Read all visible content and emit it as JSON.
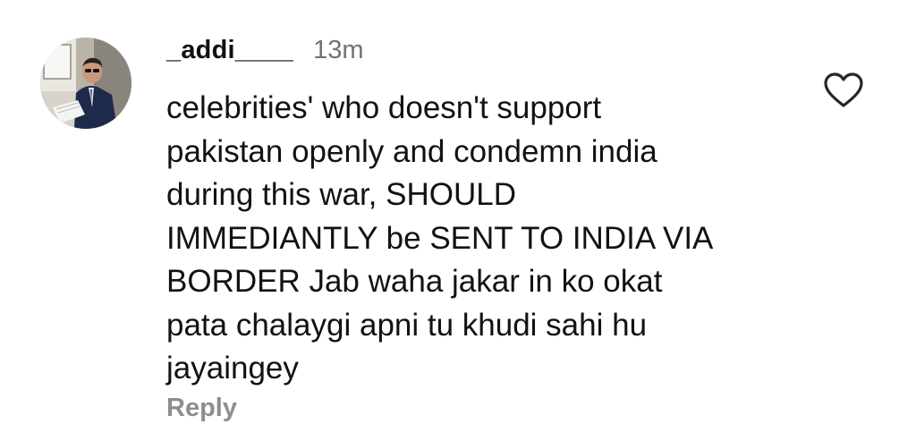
{
  "comment": {
    "username": "_addi____",
    "timestamp": "13m",
    "text": "celebrities' who doesn't support\npakistan openly and condemn india\nduring this war, SHOULD\nIMMEDIANTLY be SENT TO INDIA VIA\nBORDER Jab waha jakar in ko okat\npata chalaygi apni  tu khudi sahi hu\njayaingey",
    "reply_label": "Reply"
  },
  "icons": {
    "avatar": "profile-photo-avatar",
    "like": "heart-outline-icon"
  },
  "colors": {
    "text_primary": "#121212",
    "text_secondary": "#737373",
    "reply": "#8e8e8e",
    "background": "#ffffff"
  }
}
